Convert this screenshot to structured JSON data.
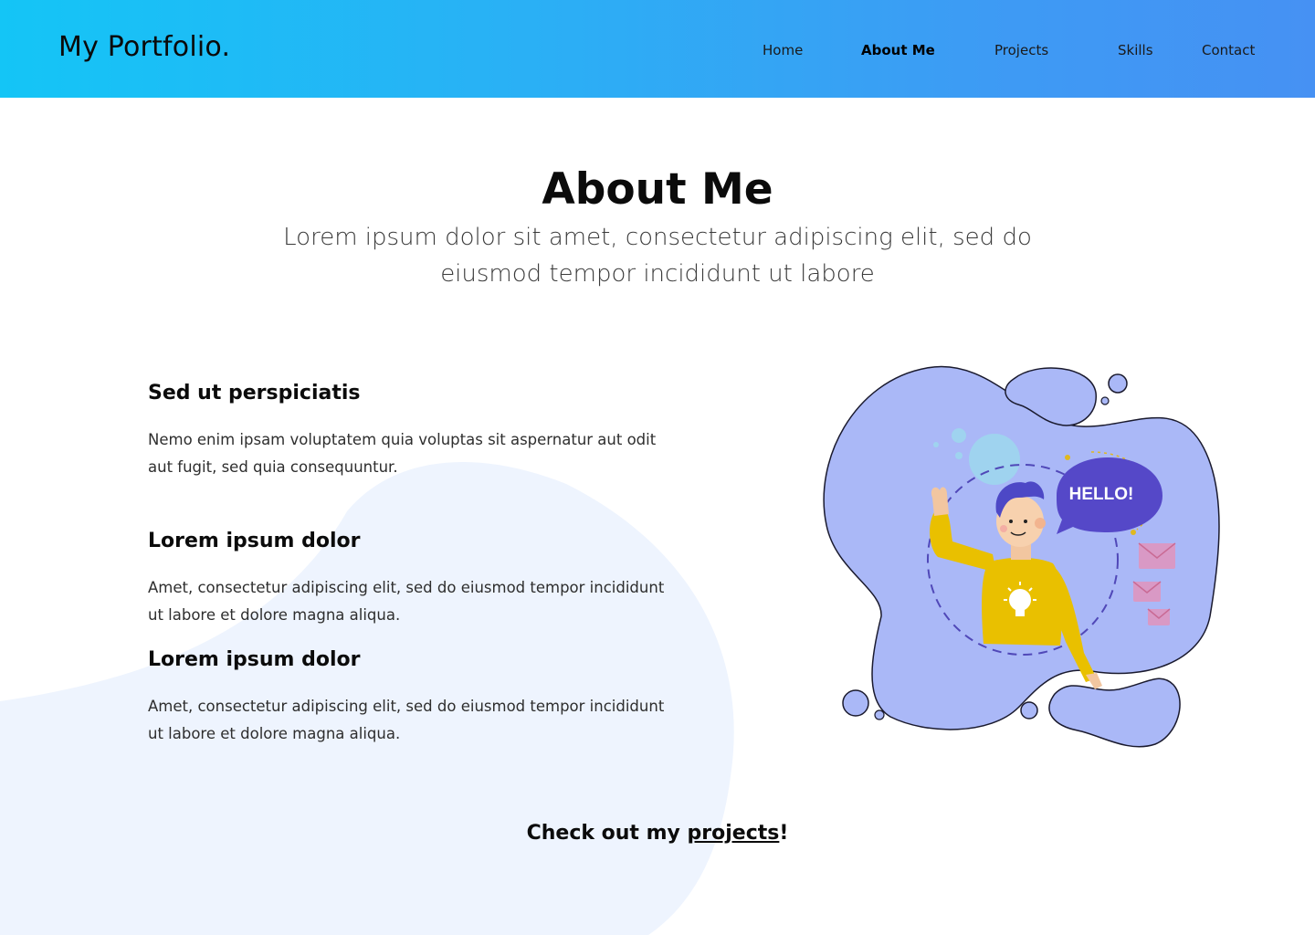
{
  "header": {
    "logo": "My Portfolio.",
    "nav": [
      {
        "label": "Home",
        "active": false
      },
      {
        "label": "About Me",
        "active": true
      },
      {
        "label": "Projects",
        "active": false
      },
      {
        "label": "Skills",
        "active": false
      },
      {
        "label": "Contact",
        "active": false
      }
    ]
  },
  "hero": {
    "title": "About Me",
    "subtitle": "Lorem ipsum dolor sit amet, consectetur adipiscing elit, sed do eiusmod tempor incididunt ut labore"
  },
  "sections": [
    {
      "heading": "Sed ut perspiciatis",
      "text": "Nemo enim ipsam voluptatem quia voluptas sit aspernatur aut odit aut fugit, sed quia consequuntur."
    },
    {
      "heading": "Lorem ipsum dolor",
      "text": "Amet, consectetur adipiscing elit, sed do eiusmod tempor incididunt ut labore et dolore magna aliqua."
    },
    {
      "heading": "Lorem ipsum dolor",
      "text": "Amet, consectetur adipiscing elit, sed do eiusmod tempor incididunt ut labore et dolore magna aliqua."
    }
  ],
  "illustration": {
    "bubble_text": "HELLO!",
    "blob_color": "#aab8f7",
    "shirt_color": "#e9c000"
  },
  "cta": {
    "prefix": "Check out my ",
    "link": "projects",
    "suffix": "!"
  },
  "colors": {
    "header_gradient_start": "#14c5f6",
    "header_gradient_end": "#4691f3",
    "background_blob": "#eef4fe"
  }
}
